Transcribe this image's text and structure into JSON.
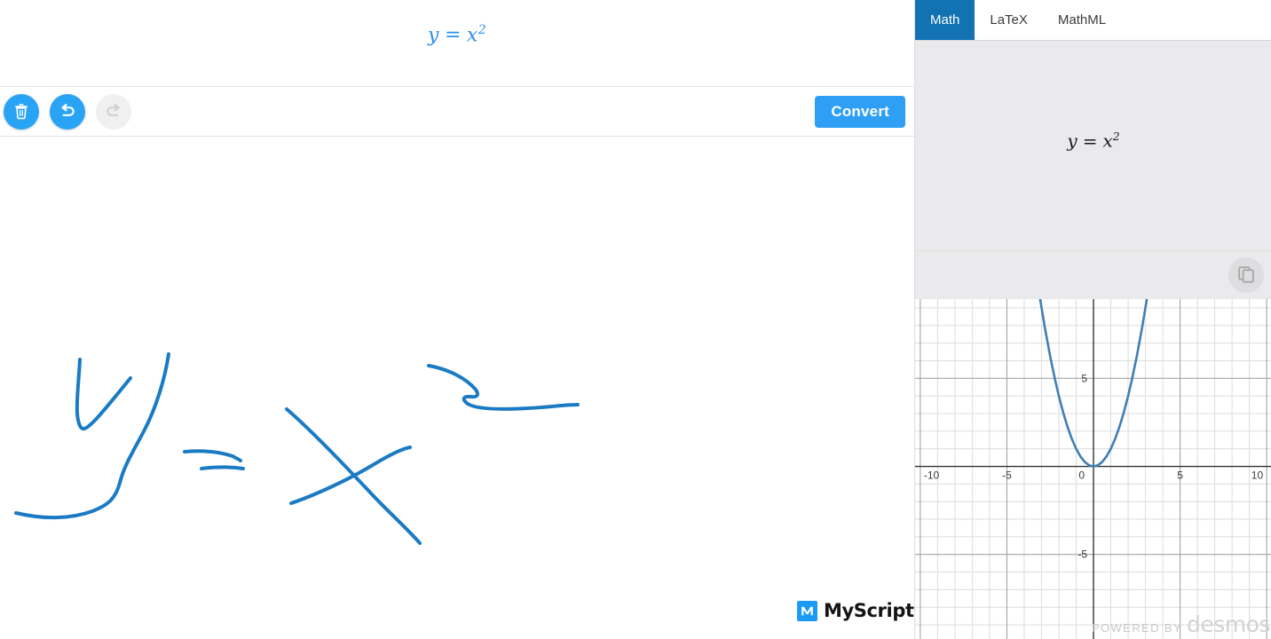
{
  "app": {
    "brand_name": "MyScript.",
    "brand_mark_letter": "M"
  },
  "result": {
    "lhs": "y",
    "equals": "=",
    "rhs_base": "x",
    "rhs_exponent": "2",
    "color": "#2b8fe8"
  },
  "toolbar": {
    "clear_label": "Clear",
    "clear_icon": "trash-icon",
    "undo_label": "Undo",
    "undo_icon": "undo-arrow-icon",
    "redo_label": "Redo",
    "redo_icon": "redo-arrow-icon",
    "redo_disabled": true,
    "convert_label": "Convert",
    "convert_color": "#2f9ff5",
    "active_color": "#29a4f5",
    "disabled_color": "#f0f0f0"
  },
  "ink": {
    "stroke_color": "#1a7bc4",
    "stroke_width": 4,
    "description": "handwritten y = x squared"
  },
  "panel": {
    "tabs": [
      {
        "label": "Math",
        "active": true
      },
      {
        "label": "LaTeX",
        "active": false
      },
      {
        "label": "MathML",
        "active": false
      }
    ],
    "active_tab_color": "#1272b4",
    "preview": {
      "lhs": "y",
      "equals": "=",
      "rhs_base": "x",
      "rhs_exponent": "2",
      "color": "#1a1a28"
    },
    "copy_button_label": "Copy",
    "copy_icon": "copy-icon"
  },
  "graph": {
    "watermark_prefix": "POWERED BY",
    "watermark_brand": "desmos",
    "curve_color": "#3f7fb5",
    "axis_color": "#333333",
    "grid_color": "#dcdcdc",
    "major_grid_color": "#9a9a9a"
  },
  "chart_data": {
    "type": "line",
    "title": "",
    "expression": "y = x^2",
    "xlabel": "",
    "ylabel": "",
    "xlim": [
      -10.3,
      10.3
    ],
    "ylim": [
      -9.8,
      9.5
    ],
    "xticks": [
      -10,
      -5,
      0,
      5,
      10
    ],
    "xtick_labels": [
      "-10",
      "-5",
      "0",
      "5",
      "10"
    ],
    "yticks": [
      5,
      0,
      -5
    ],
    "ytick_labels": [
      "5",
      "0",
      "-5"
    ],
    "grid": true,
    "grid_step": 1,
    "major_grid_step": 5,
    "legend": "none",
    "series": [
      {
        "name": "y = x^2",
        "x": [
          -3.1,
          -2.8,
          -2.5,
          -2.2,
          -2.0,
          -1.75,
          -1.5,
          -1.25,
          -1.0,
          -0.75,
          -0.5,
          -0.25,
          0,
          0.25,
          0.5,
          0.75,
          1.0,
          1.25,
          1.5,
          1.75,
          2.0,
          2.2,
          2.5,
          2.8,
          3.1
        ],
        "y": [
          9.61,
          7.84,
          6.25,
          4.84,
          4.0,
          3.0625,
          2.25,
          1.5625,
          1.0,
          0.5625,
          0.25,
          0.0625,
          0,
          0.0625,
          0.25,
          0.5625,
          1.0,
          1.5625,
          2.25,
          3.0625,
          4.0,
          4.84,
          6.25,
          7.84,
          9.61
        ]
      }
    ]
  }
}
